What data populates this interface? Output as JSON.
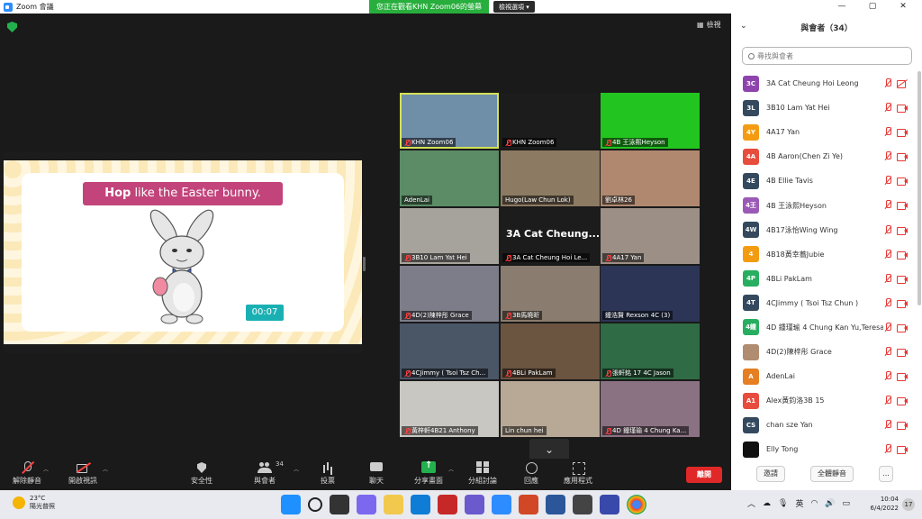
{
  "window": {
    "title": "Zoom 會議",
    "controls": [
      "—",
      "▢",
      "✕"
    ]
  },
  "share_banner": {
    "text": "您正在觀看KHN Zoom06的螢幕",
    "view_options": "檢視選項 ▾"
  },
  "gallery_button": "檢視",
  "slide": {
    "title_bold": "Hop",
    "title_rest": " like the Easter bunny.",
    "timer": "00:07"
  },
  "tiles": [
    {
      "name": "KHN Zoom06",
      "muted": true,
      "bg": "#6f8ea8",
      "active": true
    },
    {
      "name": "KHN Zoom06",
      "muted": true,
      "bg": "#1c1c1c"
    },
    {
      "name": "4B 王泳熙Heyson",
      "muted": true,
      "bg": "#22c51f"
    },
    {
      "name": "AdenLai",
      "muted": false,
      "bg": "#5b8c66"
    },
    {
      "name": "Hugo(Law Chun Lok)",
      "muted": false,
      "bg": "#8c7a62"
    },
    {
      "name": "劉卓林26",
      "muted": false,
      "bg": "#b08870"
    },
    {
      "name": "3B10 Lam Yat Hei",
      "muted": true,
      "bg": "#a6a39c"
    },
    {
      "name": "3A Cat Cheung Hoi Le...",
      "muted": true,
      "bg": "#1c1c1c",
      "big": "3A Cat Cheung..."
    },
    {
      "name": "4A17 Yan",
      "muted": true,
      "bg": "#9c8f86"
    },
    {
      "name": "4D(2)陳梓彤 Grace",
      "muted": true,
      "bg": "#7d7d8a"
    },
    {
      "name": "3B馬曉昕",
      "muted": true,
      "bg": "#8a7c6e"
    },
    {
      "name": "鍾浩賢 Rexson 4C (3)",
      "muted": false,
      "bg": "#2c3556"
    },
    {
      "name": "4CJimmy ( Tsoi Tsz Ch...",
      "muted": true,
      "bg": "#4a5566"
    },
    {
      "name": "4BLi PakLam",
      "muted": true,
      "bg": "#6b5440"
    },
    {
      "name": "張軒銘 17 4C Jason",
      "muted": true,
      "bg": "#2f6b45"
    },
    {
      "name": "黃梓軒4B21 Anthony",
      "muted": true,
      "bg": "#c9c7c2"
    },
    {
      "name": "Lin chun hei",
      "muted": false,
      "bg": "#b8a896"
    },
    {
      "name": "4D 鍾瑾瑜 4 Chung Ka...",
      "muted": true,
      "bg": "#8a7282"
    }
  ],
  "toolbar": {
    "unmute": "解除靜音",
    "start_video": "開啟視訊",
    "security": "安全性",
    "participants": "與會者",
    "participants_count": "34",
    "polls": "投票",
    "chat": "聊天",
    "share_screen": "分享畫面",
    "breakout": "分組討論",
    "reactions": "回應",
    "apps": "應用程式",
    "leave": "離開"
  },
  "panel": {
    "title": "與會者（34）",
    "search_placeholder": "尋找與會者",
    "participants": [
      {
        "badge": "3C",
        "color": "#8e44ad",
        "name": "3A Cat Cheung Hoi Leong",
        "cam_slash": true
      },
      {
        "badge": "3L",
        "color": "#34495e",
        "name": "3B10 Lam Yat Hei"
      },
      {
        "badge": "4Y",
        "color": "#f39c12",
        "name": "4A17 Yan"
      },
      {
        "badge": "4A",
        "color": "#e74c3c",
        "name": "4B Aaron(Chen Zi Ye)"
      },
      {
        "badge": "4E",
        "color": "#34495e",
        "name": "4B Ellie Tavis"
      },
      {
        "badge": "4王",
        "color": "#9b59b6",
        "name": "4B 王泳熙Heyson"
      },
      {
        "badge": "4W",
        "color": "#34495e",
        "name": "4B17泳怡Wing Wing"
      },
      {
        "badge": "4",
        "color": "#f39c12",
        "name": "4B18黃幸蕎Jubie"
      },
      {
        "badge": "4P",
        "color": "#27ae60",
        "name": "4BLi PakLam"
      },
      {
        "badge": "4T",
        "color": "#34495e",
        "name": "4CJimmy ( Tsoi Tsz Chun )"
      },
      {
        "badge": "4鍾",
        "color": "#27ae60",
        "name": "4D 鍾瑾瑜 4 Chung Kan Yu,Teresa"
      },
      {
        "badge": "",
        "color": "#b08c70",
        "name": "4D(2)陳梓彤 Grace"
      },
      {
        "badge": "A",
        "color": "#e67e22",
        "name": "AdenLai"
      },
      {
        "badge": "A1",
        "color": "#e74c3c",
        "name": "Alex黃鈞洛3B 15"
      },
      {
        "badge": "CS",
        "color": "#34495e",
        "name": "chan sze Yan"
      },
      {
        "badge": "",
        "color": "#111111",
        "name": "Elly Tong"
      }
    ],
    "invite": "邀請",
    "mute_all": "全體靜音",
    "more": "..."
  },
  "taskbar": {
    "temp": "23°C",
    "weather": "陽光普照",
    "ime": "英",
    "time": "10:04",
    "date": "6/4/2022",
    "notifications": "17"
  }
}
